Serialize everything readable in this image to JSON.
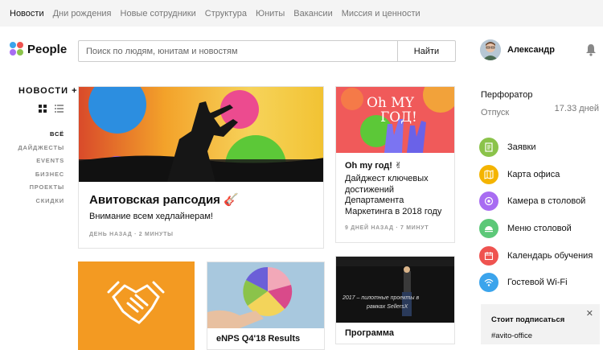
{
  "topnav": {
    "items": [
      "Новости",
      "Дни рождения",
      "Новые сотрудники",
      "Структура",
      "Юниты",
      "Вакансии",
      "Миссия и ценности"
    ]
  },
  "header": {
    "logo_text": "People",
    "search_placeholder": "Поиск по людям, юнитам и новостям",
    "search_button": "Найти",
    "user_name": "Александр"
  },
  "sidebar": {
    "news_heading": "НОВОСТИ +",
    "filters": [
      "ВСЁ",
      "ДАЙДЖЕСТЫ",
      "EVENTS",
      "БИЗНЕС",
      "ПРОЕКТЫ",
      "СКИДКИ"
    ]
  },
  "cards": {
    "main": {
      "title": "Авитовская рапсодия 🎸",
      "text": "Внимание всем хедлайнерам!",
      "meta": "ДЕНЬ НАЗАД · 2 МИНУТЫ"
    },
    "ohmy": {
      "image_text_1": "Oh MY",
      "image_text_2": "ГОД!",
      "title": "Oh my год! ✌",
      "text_lines": [
        "Дайджест ключевых",
        "достижений",
        "Департамента",
        "Маркетинга в 2018 году"
      ],
      "meta": "9 ДНЕЙ НАЗАД · 7 МИНУТ"
    },
    "enps": {
      "title": "eNPS Q4'18 Results"
    },
    "program": {
      "title": "Программа",
      "image_text_1": "2017 – пилотные проекты в",
      "image_text_2": "рамках SellersX"
    }
  },
  "right": {
    "title": "Перфоратор",
    "vacation_label": "Отпуск",
    "vacation_value": "17.33 дней",
    "links": [
      {
        "label": "Заявки",
        "color": "#8bc34a"
      },
      {
        "label": "Карта офиса",
        "color": "#f4b400"
      },
      {
        "label": "Камера в столовой",
        "color": "#a86cf2"
      },
      {
        "label": "Меню столовой",
        "color": "#5cc878"
      },
      {
        "label": "Календарь обучения",
        "color": "#ef5350"
      },
      {
        "label": "Гостевой Wi-Fi",
        "color": "#3ba4ec"
      }
    ],
    "subscribe_title": "Стоит подписаться",
    "subscribe_channel": "#avito-office"
  }
}
